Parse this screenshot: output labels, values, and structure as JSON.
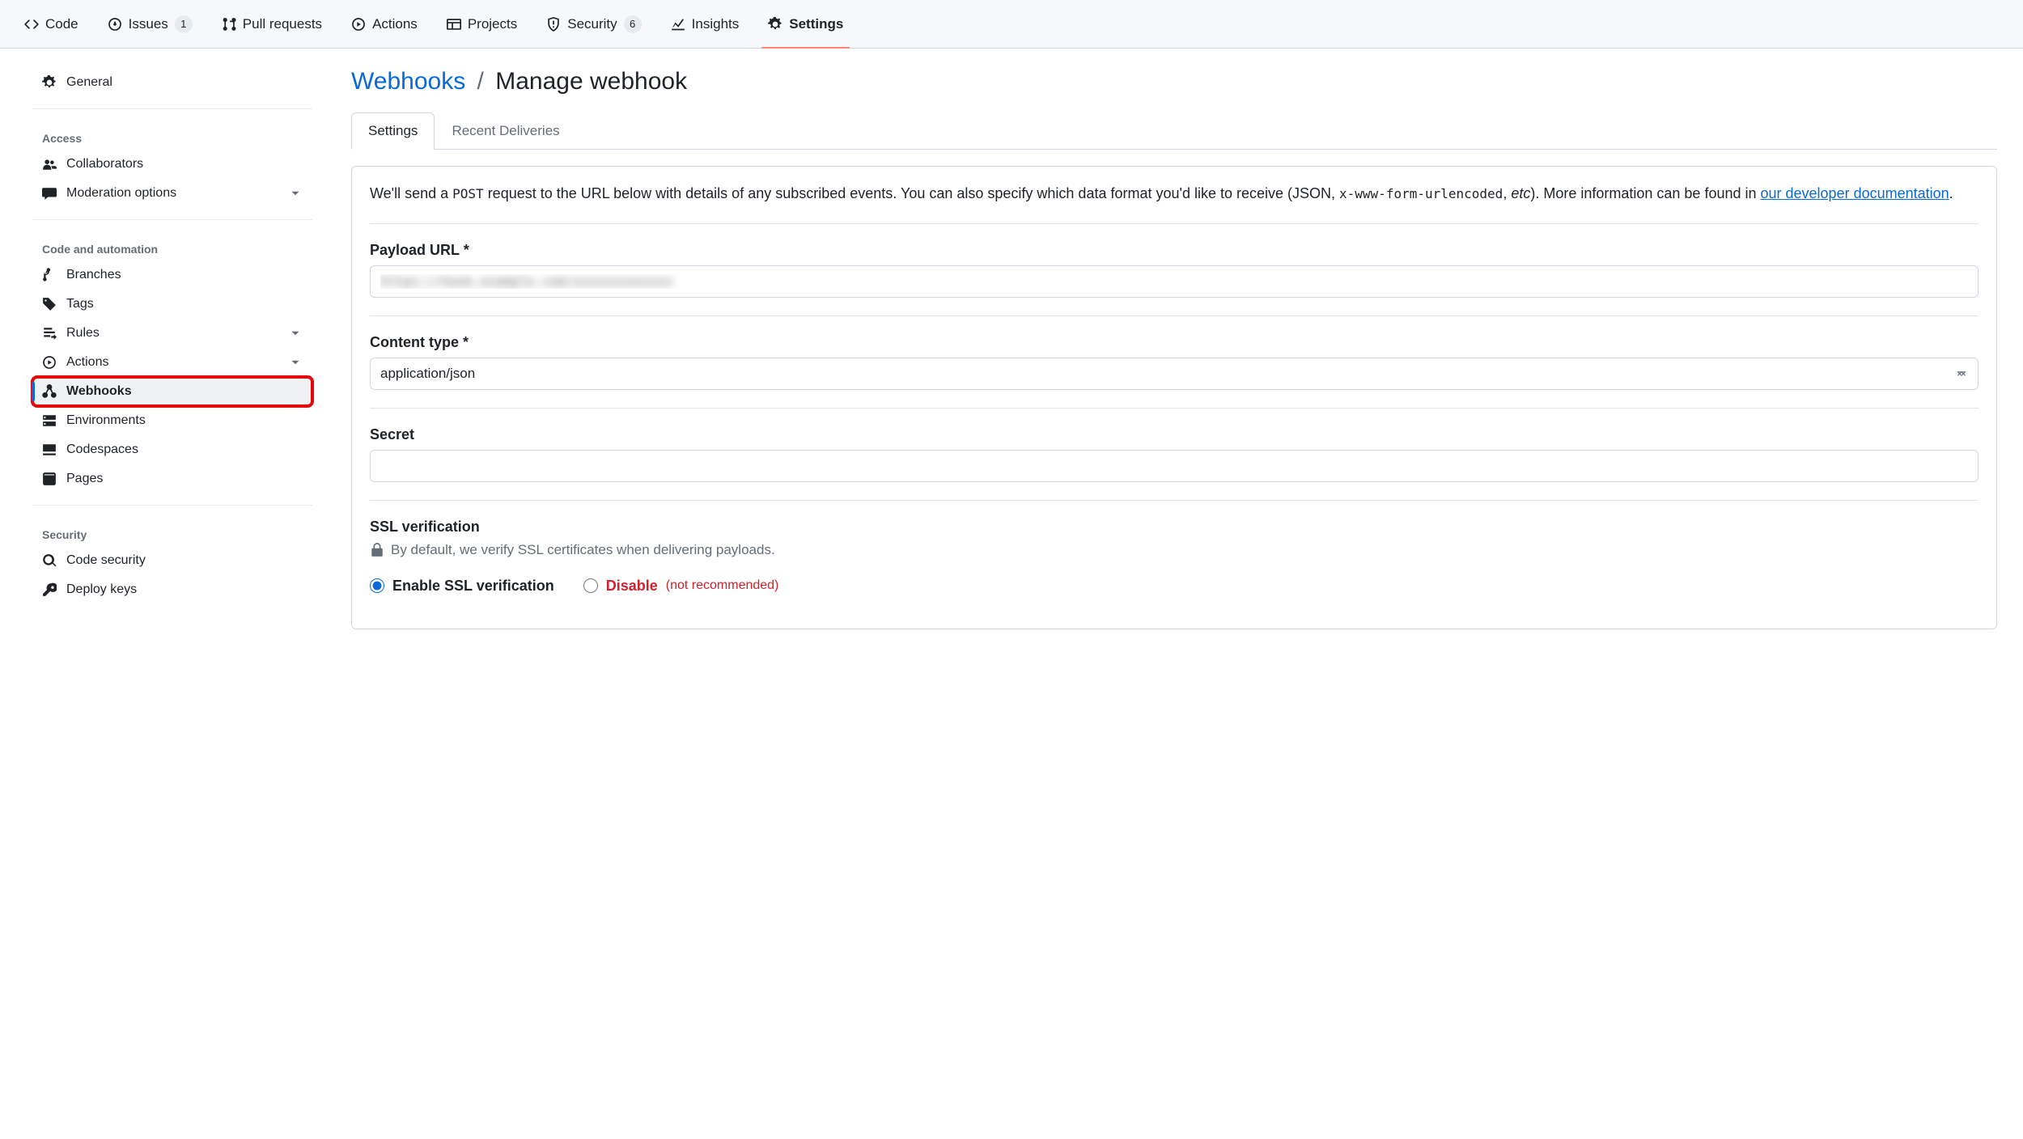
{
  "top_nav": {
    "code": "Code",
    "issues": "Issues",
    "issues_count": "1",
    "pulls": "Pull requests",
    "actions": "Actions",
    "projects": "Projects",
    "security": "Security",
    "security_count": "6",
    "insights": "Insights",
    "settings": "Settings"
  },
  "sidebar": {
    "general": "General",
    "section_access": "Access",
    "collaborators": "Collaborators",
    "moderation": "Moderation options",
    "section_code_auto": "Code and automation",
    "branches": "Branches",
    "tags": "Tags",
    "rules": "Rules",
    "actions": "Actions",
    "webhooks": "Webhooks",
    "environments": "Environments",
    "codespaces": "Codespaces",
    "pages": "Pages",
    "section_security": "Security",
    "code_security": "Code security",
    "deploy_keys": "Deploy keys"
  },
  "breadcrumb": {
    "root": "Webhooks",
    "current": "Manage webhook"
  },
  "tabs": {
    "settings": "Settings",
    "deliveries": "Recent Deliveries"
  },
  "intro": {
    "part1": "We'll send a ",
    "code1": "POST",
    "part2": " request to the URL below with details of any subscribed events. You can also specify which data format you'd like to receive (JSON, ",
    "code2": "x-www-form-urlencoded",
    "part3": ", ",
    "em": "etc",
    "part4": "). More information can be found in ",
    "link": "our developer documentation",
    "end": "."
  },
  "form": {
    "payload_label": "Payload URL *",
    "payload_value": "https://hook.example.com/xxxxxxxxxxxxx",
    "content_type_label": "Content type *",
    "content_type_value": "application/json",
    "secret_label": "Secret",
    "secret_value": "",
    "ssl_title": "SSL verification",
    "ssl_sub": "By default, we verify SSL certificates when delivering payloads.",
    "ssl_enable": "Enable SSL verification",
    "ssl_disable": "Disable",
    "ssl_not_rec": "(not recommended)"
  }
}
